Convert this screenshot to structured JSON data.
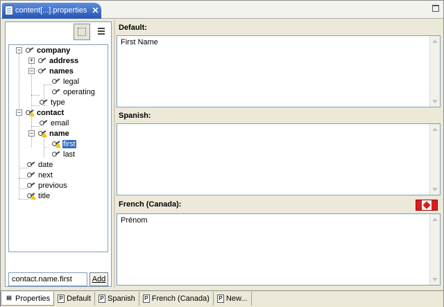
{
  "editor_tab": {
    "title": "content[...].properties",
    "close": "✕"
  },
  "tree": {
    "nodes": [
      {
        "label": "company",
        "bold": true
      },
      {
        "label": "address",
        "bold": true
      },
      {
        "label": "names",
        "bold": true
      },
      {
        "label": "legal",
        "bold": false
      },
      {
        "label": "operating",
        "bold": false
      },
      {
        "label": "type",
        "bold": false
      },
      {
        "label": "contact",
        "bold": true
      },
      {
        "label": "email",
        "bold": false
      },
      {
        "label": "name",
        "bold": true
      },
      {
        "label": "first",
        "bold": false
      },
      {
        "label": "last",
        "bold": false
      },
      {
        "label": "date",
        "bold": false
      },
      {
        "label": "next",
        "bold": false
      },
      {
        "label": "previous",
        "bold": false
      },
      {
        "label": "title",
        "bold": false
      }
    ],
    "selected": "first"
  },
  "key_input": {
    "value": "contact.name.first"
  },
  "add_button": {
    "label": "Add"
  },
  "sections": [
    {
      "label": "Default:",
      "value": "First Name"
    },
    {
      "label": "Spanish:",
      "value": ""
    },
    {
      "label": "French (Canada):",
      "value": "Prénom"
    }
  ],
  "bottom_tabs": [
    {
      "label": "Properties",
      "active": true
    },
    {
      "label": "Default",
      "active": false
    },
    {
      "label": "Spanish",
      "active": false
    },
    {
      "label": "French (Canada)",
      "active": false
    },
    {
      "label": "New...",
      "active": false
    }
  ],
  "colors": {
    "selection": "#316ac5",
    "tab_active": "#2555b0",
    "flag_red": "#d5201e",
    "warning": "#f5c400"
  },
  "icons": {
    "key": "key-icon",
    "warning": "warning-icon",
    "flag": "canada-flag-icon",
    "properties_file": "properties-file-icon"
  }
}
